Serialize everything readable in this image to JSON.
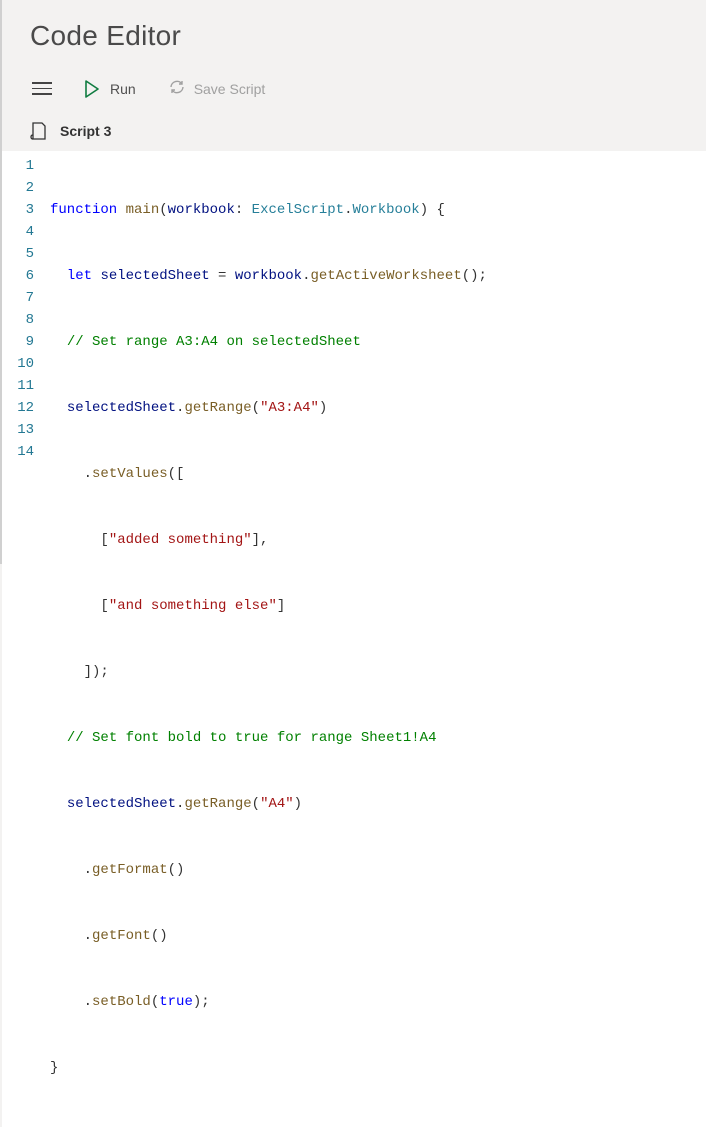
{
  "header": {
    "title": "Code Editor"
  },
  "toolbar": {
    "run_label": "Run",
    "save_label": "Save Script"
  },
  "script": {
    "name": "Script 3"
  },
  "editor": {
    "line_numbers": [
      "1",
      "2",
      "3",
      "4",
      "5",
      "6",
      "7",
      "8",
      "9",
      "10",
      "11",
      "12",
      "13",
      "14"
    ]
  },
  "code": {
    "l1": {
      "kw1": "function",
      "fn": "main",
      "p1": "(",
      "param": "workbook",
      "colon": ": ",
      "type1": "ExcelScript",
      "dot": ".",
      "type2": "Workbook",
      "p2": ") {"
    },
    "l2": {
      "ind": "  ",
      "kw": "let",
      "sp": " ",
      "var": "selectedSheet",
      "eq": " = ",
      "obj": "workbook",
      "dot": ".",
      "m": "getActiveWorksheet",
      "call": "();"
    },
    "l3": {
      "ind": "  ",
      "cm": "// Set range A3:A4 on selectedSheet"
    },
    "l4": {
      "ind": "  ",
      "obj": "selectedSheet",
      "dot": ".",
      "m": "getRange",
      "p1": "(",
      "str": "\"A3:A4\"",
      "p2": ")"
    },
    "l5": {
      "ind": "    ",
      "dot": ".",
      "m": "setValues",
      "p1": "(["
    },
    "l6": {
      "ind": "      ",
      "p1": "[",
      "str": "\"added something\"",
      "p2": "],"
    },
    "l7": {
      "ind": "      ",
      "p1": "[",
      "str": "\"and something else\"",
      "p2": "]"
    },
    "l8": {
      "ind": "    ",
      "cl": "]);"
    },
    "l9": {
      "ind": "  ",
      "cm": "// Set font bold to true for range Sheet1!A4"
    },
    "l10": {
      "ind": "  ",
      "obj": "selectedSheet",
      "dot": ".",
      "m": "getRange",
      "p1": "(",
      "str": "\"A4\"",
      "p2": ")"
    },
    "l11": {
      "ind": "    ",
      "dot": ".",
      "m": "getFormat",
      "call": "()"
    },
    "l12": {
      "ind": "    ",
      "dot": ".",
      "m": "getFont",
      "call": "()"
    },
    "l13": {
      "ind": "    ",
      "dot": ".",
      "m": "setBold",
      "p1": "(",
      "kw": "true",
      "p2": ");"
    },
    "l14": {
      "cl": "}"
    }
  }
}
